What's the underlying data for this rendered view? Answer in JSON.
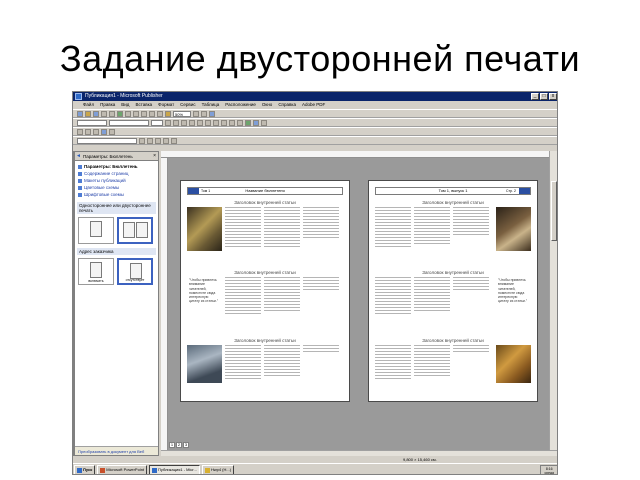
{
  "slide": {
    "title": "Задание двусторонней печати"
  },
  "window": {
    "title": "Публикация1 - Microsoft Publisher",
    "min": "_",
    "max": "□",
    "close": "x"
  },
  "menu": [
    "Файл",
    "Правка",
    "Вид",
    "Вставка",
    "Формат",
    "Сервис",
    "Таблица",
    "Расположение",
    "Окно",
    "Справка",
    "Adobe PDF"
  ],
  "toolbar": {
    "zoom": "50%"
  },
  "taskpane": {
    "title": "Параметры: Бюллетень",
    "items": [
      "Параметры: Бюллетень",
      "Содержание страниц",
      "Макеты публикаций",
      "Цветовые схемы",
      "Шрифтовые схемы"
    ],
    "section1": "Одностороннее или двустороннее печать",
    "section2": "Адрес заказчика",
    "opt1": "включить",
    "opt2": "отсутствует",
    "footer": "Преобразовать в документ для Веб"
  },
  "pages": {
    "left_header": "Название бюллетеня",
    "left_small": "Том 1",
    "right_header": "Том 1, выпуск 1",
    "right_small": "Стр. 2",
    "article_title": "Заголовок внутренней статьи",
    "quote_left": "\"Чтобы привлечь внимание читателей, поместите сюда интересную цитату из статьи.\"",
    "quote_right": "\"Чтобы привлечь внимание читателей, поместите сюда интересную цитату из статьи.\""
  },
  "pagenav": [
    "1",
    "2",
    "3"
  ],
  "status": {
    "coords": "9,800 × 15,460 см."
  },
  "taskbar": {
    "start": "Пуск",
    "buttons": [
      "Microsoft PowerPoint",
      "Публикация1 - Micr...",
      "Hwp4 (Н...)"
    ],
    "tray_time": "8:16",
    "tray_day": "среда"
  }
}
